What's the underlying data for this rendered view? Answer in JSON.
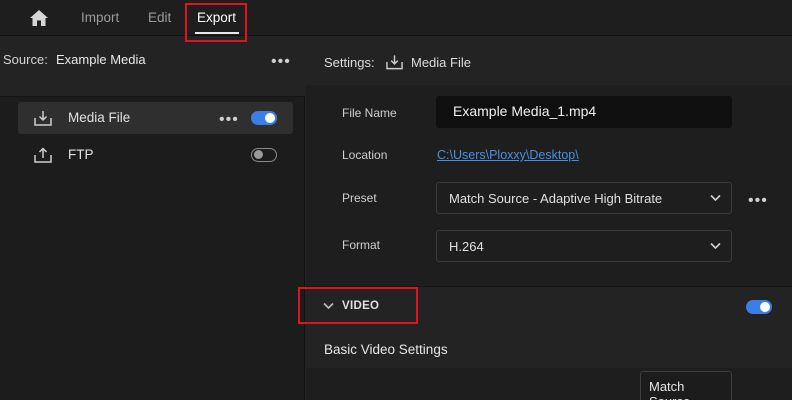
{
  "header": {
    "home_icon": "home-icon",
    "tabs": [
      {
        "label": "Import"
      },
      {
        "label": "Edit"
      },
      {
        "label": "Export"
      }
    ],
    "active_tab": "Export"
  },
  "source": {
    "label": "Source:",
    "value": "Example Media",
    "more_icon": "more-horizontal-icon"
  },
  "destinations": [
    {
      "label": "Media File",
      "icon": "download-icon",
      "enabled": true,
      "selected": true
    },
    {
      "label": "FTP",
      "icon": "upload-icon",
      "enabled": false,
      "selected": false
    }
  ],
  "settings": {
    "heading": "Settings:",
    "destination": "Media File",
    "file_name_label": "File Name",
    "file_name_value": "Example Media_1.mp4",
    "location_label": "Location",
    "location_value": "C:\\Users\\Ploxxy\\Desktop\\",
    "preset_label": "Preset",
    "preset_value": "Match Source - Adaptive High Bitrate",
    "format_label": "Format",
    "format_value": "H.264"
  },
  "video": {
    "label": "VIDEO",
    "enabled": true,
    "basic_title": "Basic Video Settings",
    "match_source_label": "Match Source"
  },
  "colors": {
    "accent": "#3a7ee6",
    "highlight_box": "#e1131b",
    "link": "#4a90e2"
  }
}
